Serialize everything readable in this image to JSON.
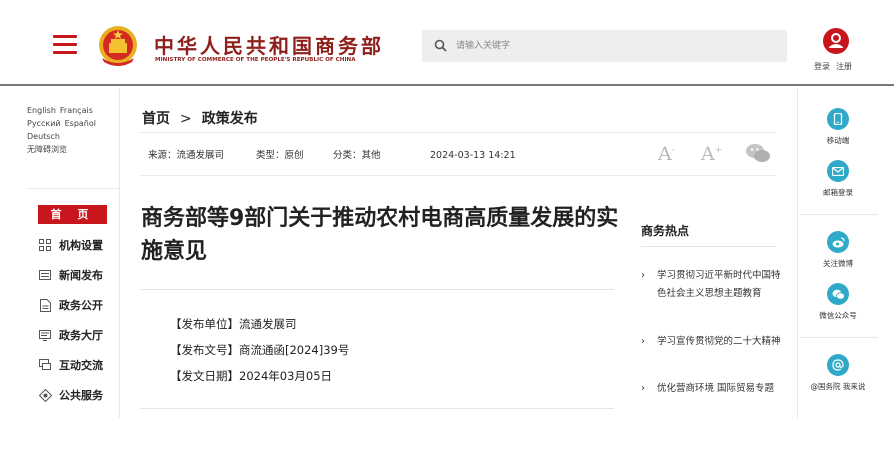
{
  "header": {
    "site_title": "中华人民共和国商务部",
    "site_subtitle": "MINISTRY OF COMMERCE OF THE PEOPLE'S REPUBLIC OF CHINA",
    "search_placeholder": "请输入关键字",
    "login_label": "登录",
    "register_label": "注册",
    "brand_color": "#c8161d"
  },
  "languages": [
    "English",
    "Français",
    "Русский",
    "Español",
    "Deutsch",
    "无障碍浏览"
  ],
  "nav": {
    "home": "首 页",
    "items": [
      {
        "label": "机构设置",
        "icon": "org-icon"
      },
      {
        "label": "新闻发布",
        "icon": "news-icon"
      },
      {
        "label": "政务公开",
        "icon": "document-icon"
      },
      {
        "label": "政务大厅",
        "icon": "hall-icon"
      },
      {
        "label": "互动交流",
        "icon": "chat-icon"
      },
      {
        "label": "公共服务",
        "icon": "service-icon"
      }
    ]
  },
  "breadcrumb": {
    "home": "首页",
    "sep": ">",
    "current": "政策发布"
  },
  "meta": {
    "source": "来源：流通发展司",
    "type": "类型：原创",
    "category": "分类：其他",
    "datetime": "2024-03-13 14:21"
  },
  "font_controls": {
    "larger": "A",
    "smaller": "A",
    "plus": "+",
    "minus": "-"
  },
  "article": {
    "title": "商务部等9部门关于推动农村电商高质量发展的实施意见",
    "issuer": "【发布单位】流通发展司",
    "doc_number": "【发布文号】商流通函[2024]39号",
    "issue_date": "【发文日期】2024年03月05日"
  },
  "hot": {
    "title": "商务热点",
    "items": [
      "学习贯彻习近平新时代中国特色社会主义思想主题教育",
      "学习宣传贯彻党的二十大精神",
      "优化营商环境 国际贸易专题"
    ]
  },
  "rightbar": [
    {
      "label": "移动端",
      "icon": "mobile-icon"
    },
    {
      "label": "邮箱登录",
      "icon": "mail-icon"
    },
    {
      "label": "关注微博",
      "icon": "weibo-icon"
    },
    {
      "label": "微信公众号",
      "icon": "wechat-icon"
    },
    {
      "label": "@国务院 我来说",
      "icon": "at-icon"
    }
  ]
}
